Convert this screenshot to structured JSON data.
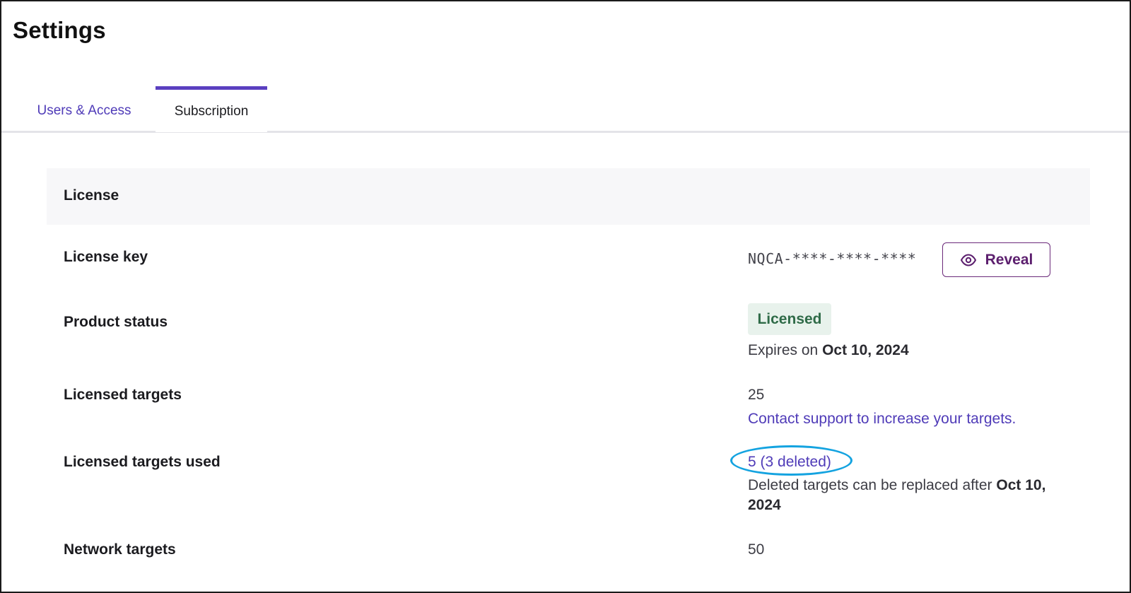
{
  "page": {
    "title": "Settings"
  },
  "tabs": [
    {
      "label": "Users & Access",
      "active": false
    },
    {
      "label": "Subscription",
      "active": true
    }
  ],
  "section": {
    "title": "License"
  },
  "rows": {
    "license_key": {
      "label": "License key",
      "value": "NQCA-****-****-****",
      "reveal_label": "Reveal",
      "reveal_icon": "eye-icon"
    },
    "product_status": {
      "label": "Product status",
      "badge": "Licensed",
      "expires_prefix": "Expires on",
      "expires_date": "Oct 10, 2024"
    },
    "licensed_targets": {
      "label": "Licensed targets",
      "value": "25",
      "link": "Contact support to increase your targets."
    },
    "licensed_targets_used": {
      "label": "Licensed targets used",
      "value_link": "5 (3 deleted)",
      "note_prefix": "Deleted targets can be replaced after",
      "note_date": "Oct 10, 2024"
    },
    "network_targets": {
      "label": "Network targets",
      "value": "50"
    }
  },
  "colors": {
    "accent": "#5a3fc0",
    "link": "#4f3bb8",
    "reveal_border": "#6b2a7a",
    "badge_bg": "#e8f2ec",
    "badge_text": "#2f6b48",
    "highlight_circle": "#14a3e0"
  }
}
